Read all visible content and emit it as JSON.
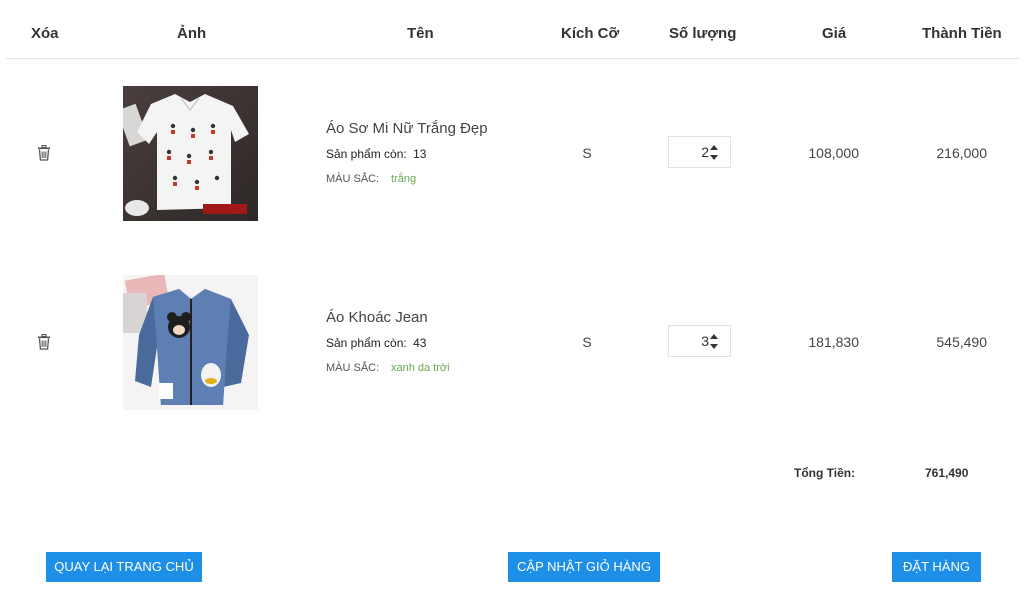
{
  "table": {
    "headers": {
      "delete": "Xóa",
      "image": "Ảnh",
      "name": "Tên",
      "size": "Kích Cỡ",
      "quantity": "Số lượng",
      "price": "Giá",
      "total": "Thành Tiền"
    },
    "stock_label": "Sản phẩm còn:",
    "color_label": "MÀU SẮC:",
    "rows": [
      {
        "name": "Áo Sơ Mi Nữ Trắng Đẹp",
        "stock": "13",
        "color": "trắng",
        "size": "S",
        "quantity": "2",
        "price": "108,000",
        "line_total": "216,000",
        "delete_icon": "trash-icon"
      },
      {
        "name": "Áo Khoác Jean",
        "stock": "43",
        "color": "xanh da trời",
        "size": "S",
        "quantity": "3",
        "price": "181,830",
        "line_total": "545,490",
        "delete_icon": "trash-icon"
      }
    ]
  },
  "summary": {
    "total_label": "Tổng Tiền:",
    "total_value": "761,490"
  },
  "actions": {
    "back_home": "QUAY LẠI TRANG CHỦ",
    "update_cart": "CẬP NHẬT GIỎ HÀNG",
    "place_order": "ĐẶT HÀNG"
  },
  "colors": {
    "button": "#1e8fe6",
    "color_value": "#6aa84f"
  }
}
